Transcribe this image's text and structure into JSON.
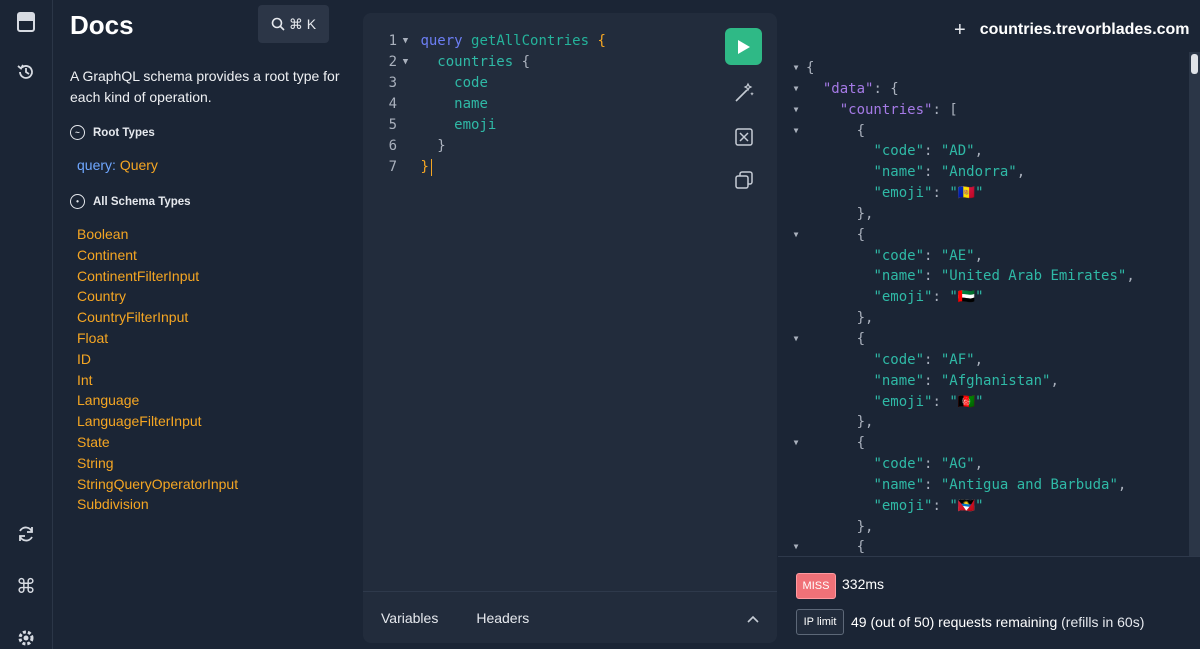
{
  "docs": {
    "title": "Docs",
    "search_shortcut": "⌘ K",
    "description": "A GraphQL schema provides a root type for each kind of operation.",
    "root_types_heading": "Root Types",
    "root_query_keyword": "query",
    "root_query_sep": ": ",
    "root_query_type": "Query",
    "all_types_heading": "All Schema Types",
    "types": [
      "Boolean",
      "Continent",
      "ContinentFilterInput",
      "Country",
      "CountryFilterInput",
      "Float",
      "ID",
      "Int",
      "Language",
      "LanguageFilterInput",
      "State",
      "String",
      "StringQueryOperatorInput",
      "Subdivision"
    ]
  },
  "editor": {
    "lines": [
      {
        "num": "1",
        "kw": "query",
        "name": "getAllContries",
        "brace": "{"
      },
      {
        "num": "2",
        "field": "countries",
        "brace": "{"
      },
      {
        "num": "3",
        "field": "code"
      },
      {
        "num": "4",
        "field": "name"
      },
      {
        "num": "5",
        "field": "emoji"
      },
      {
        "num": "6",
        "close": "}"
      },
      {
        "num": "7",
        "close": "}"
      }
    ],
    "tab_variables": "Variables",
    "tab_headers": "Headers"
  },
  "response": {
    "endpoint": "countries.trevorblades.com",
    "plus": "+",
    "status_badge": "MISS",
    "timing": "332ms",
    "ip_badge": "IP limit",
    "ip_text": "49 (out of 50) requests remaining",
    "ip_refill": "(refills in 60s)",
    "json_lines": [
      "{",
      "  \"data\": {",
      "    \"countries\": [",
      "      {",
      "        \"code\": \"AD\",",
      "        \"name\": \"Andorra\",",
      "        \"emoji\": \"🇦🇩\"",
      "      },",
      "      {",
      "        \"code\": \"AE\",",
      "        \"name\": \"United Arab Emirates\",",
      "        \"emoji\": \"🇦🇪\"",
      "      },",
      "      {",
      "        \"code\": \"AF\",",
      "        \"name\": \"Afghanistan\",",
      "        \"emoji\": \"🇦🇫\"",
      "      },",
      "      {",
      "        \"code\": \"AG\",",
      "        \"name\": \"Antigua and Barbuda\",",
      "        \"emoji\": \"🇦🇬\"",
      "      },",
      "      {"
    ]
  },
  "icons": {
    "rail": [
      "docs-book-icon",
      "history-icon",
      "refresh-schema-icon",
      "shortcuts-icon",
      "settings-icon"
    ],
    "editor_tools": [
      "run-icon",
      "prettify-icon",
      "merge-fragments-icon",
      "copy-icon"
    ]
  },
  "colors": {
    "background": "#1b2535",
    "editor": "#222c3c",
    "keyword": "#6c7ef4",
    "type": "#f5a623",
    "field": "#2fb9a6",
    "run": "#2fb986",
    "miss": "#f07178"
  }
}
